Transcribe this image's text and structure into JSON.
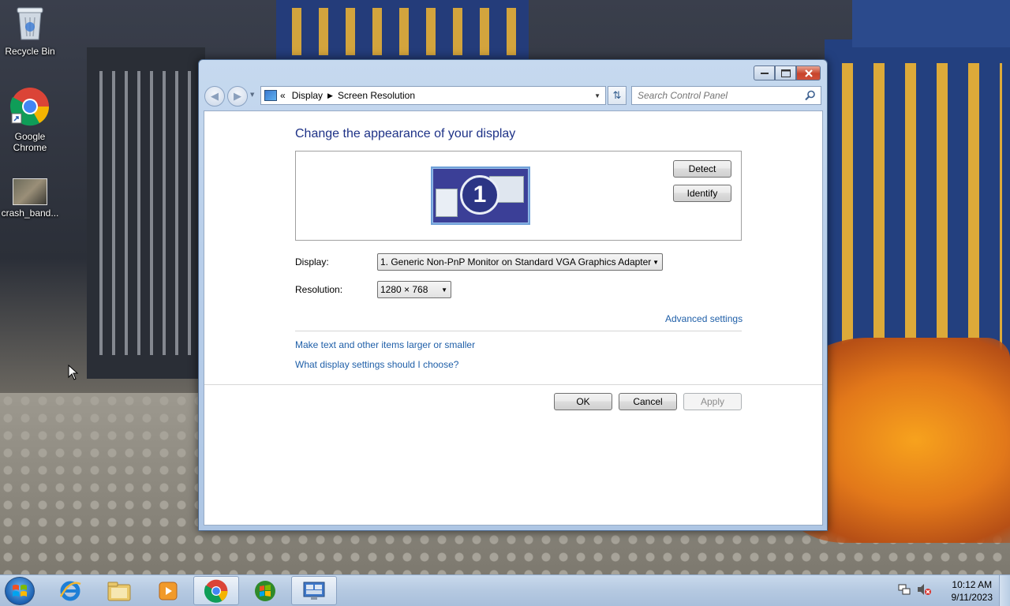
{
  "desktop": {
    "icons": [
      {
        "label": "Recycle Bin",
        "icon": "recycle-bin-icon"
      },
      {
        "label": "Google Chrome",
        "icon": "chrome-icon"
      },
      {
        "label": "crash_band...",
        "icon": "image-file-icon"
      }
    ]
  },
  "window": {
    "address": {
      "overflow": "«",
      "crumbs": [
        "Display",
        "Screen Resolution"
      ]
    },
    "search": {
      "placeholder": "Search Control Panel"
    },
    "heading": "Change the appearance of your display",
    "monitor_number": "1",
    "detect_label": "Detect",
    "identify_label": "Identify",
    "display": {
      "label": "Display:",
      "value": "1. Generic Non-PnP Monitor on Standard VGA Graphics Adapter"
    },
    "resolution": {
      "label": "Resolution:",
      "value": "1280 × 768"
    },
    "advanced_link": "Advanced settings",
    "links": [
      "Make text and other items larger or smaller",
      "What display settings should I choose?"
    ],
    "ok_label": "OK",
    "cancel_label": "Cancel",
    "apply_label": "Apply"
  },
  "taskbar": {
    "pinned": [
      "internet-explorer-icon",
      "windows-explorer-icon",
      "media-player-icon",
      "chrome-icon",
      "windows-logo-icon",
      "control-panel-display-icon"
    ],
    "time": "10:12 AM",
    "date": "9/11/2023"
  },
  "colors": {
    "heading": "#1e3287",
    "link": "#1f5fa8",
    "taskbar": "#b5c9e1"
  }
}
